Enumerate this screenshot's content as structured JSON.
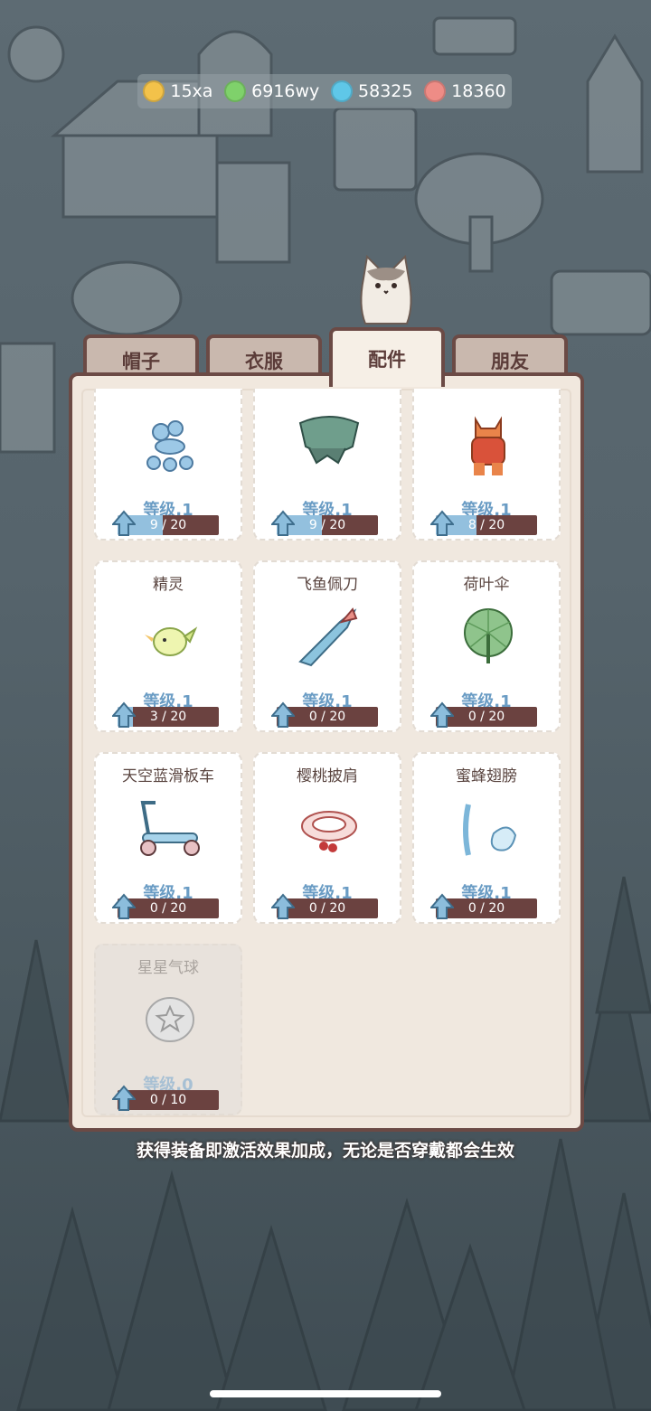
{
  "currency": [
    {
      "icon": "coin-icon",
      "value": "15xa",
      "color": "#f3c24a"
    },
    {
      "icon": "lightning-icon",
      "value": "6916wy",
      "color": "#7fd16b"
    },
    {
      "icon": "diamond-icon",
      "value": "58325",
      "color": "#5fc7e8"
    },
    {
      "icon": "yarn-icon",
      "value": "18360",
      "color": "#ee8c86"
    }
  ],
  "tabs": [
    "帽子",
    "衣服",
    "配件",
    "朋友"
  ],
  "active_tab": "配件",
  "items": [
    {
      "name": "",
      "level": "等级.1",
      "progress": "9 / 20",
      "fill": 0.45,
      "icon": "balloon-dog-icon"
    },
    {
      "name": "",
      "level": "等级.1",
      "progress": "9 / 20",
      "fill": 0.45,
      "icon": "cape-icon"
    },
    {
      "name": "",
      "level": "等级.1",
      "progress": "8 / 20",
      "fill": 0.4,
      "icon": "cat-doll-icon"
    },
    {
      "name": "精灵",
      "level": "等级.1",
      "progress": "3 / 20",
      "fill": 0.15,
      "icon": "sprite-bird-icon"
    },
    {
      "name": "飞鱼佩刀",
      "level": "等级.1",
      "progress": "0 / 20",
      "fill": 0,
      "icon": "fish-sword-icon"
    },
    {
      "name": "荷叶伞",
      "level": "等级.1",
      "progress": "0 / 20",
      "fill": 0,
      "icon": "lotus-leaf-umbrella-icon"
    },
    {
      "name": "天空蓝滑板车",
      "level": "等级.1",
      "progress": "0 / 20",
      "fill": 0,
      "icon": "scooter-icon"
    },
    {
      "name": "樱桃披肩",
      "level": "等级.1",
      "progress": "0 / 20",
      "fill": 0,
      "icon": "cherry-shawl-icon"
    },
    {
      "name": "蜜蜂翅膀",
      "level": "等级.1",
      "progress": "0 / 20",
      "fill": 0,
      "icon": "bee-wings-icon"
    },
    {
      "name": "星星气球",
      "level": "等级.0",
      "progress": "0 / 10",
      "fill": 0,
      "icon": "star-balloon-icon",
      "locked": true
    }
  ],
  "footer_note": "获得装备即激活效果加成，无论是否穿戴都会生效"
}
